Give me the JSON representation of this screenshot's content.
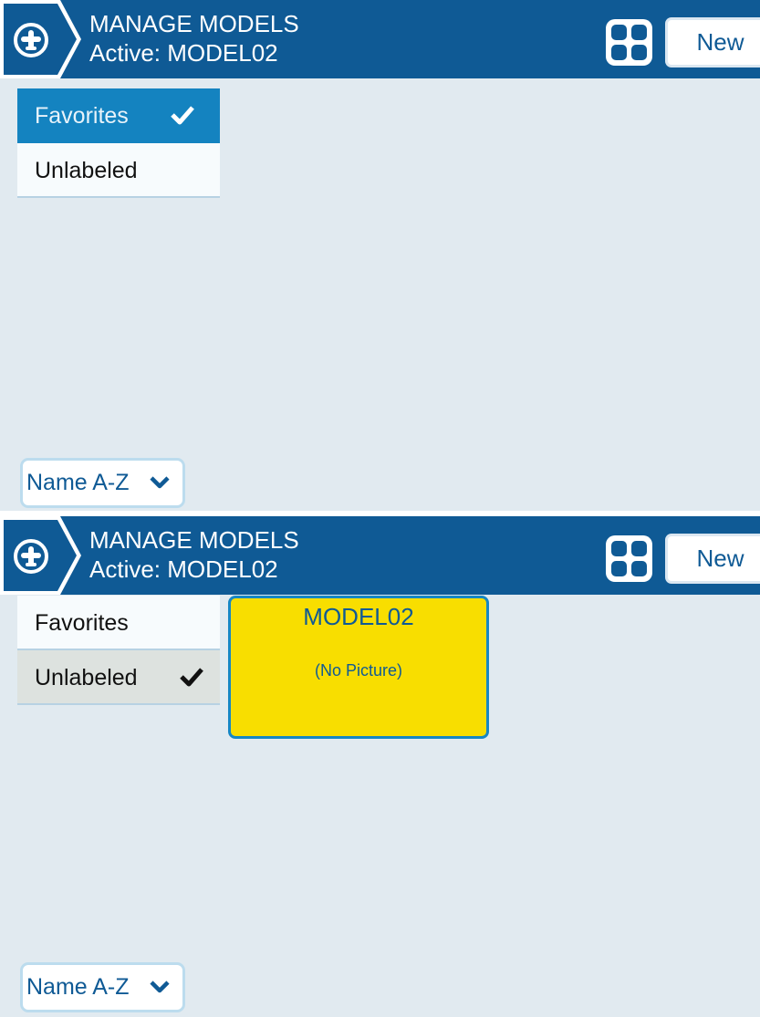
{
  "colors": {
    "header_bg": "#0f5a95",
    "screen_bg": "#e1eaf0",
    "accent_blue": "#1483c0",
    "model_card_bg": "#f8de00",
    "selected_gray": "#dde2df"
  },
  "screen1": {
    "header": {
      "title": "MANAGE MODELS",
      "active": "Active: MODEL02",
      "model_icon": "airplane-icon",
      "layout_icon": "grid-layout-icon",
      "new_label": "New"
    },
    "labels": [
      {
        "label": "Favorites",
        "selected": true
      },
      {
        "label": "Unlabeled",
        "selected": false
      }
    ],
    "sort": {
      "value": "Name A-Z",
      "icon": "chevron-down-icon"
    }
  },
  "screen2": {
    "header": {
      "title": "MANAGE MODELS",
      "active": "Active: MODEL02",
      "model_icon": "airplane-icon",
      "layout_icon": "grid-layout-icon",
      "new_label": "New"
    },
    "labels": [
      {
        "label": "Favorites",
        "selected": false
      },
      {
        "label": "Unlabeled",
        "selected": true
      }
    ],
    "models": [
      {
        "name": "MODEL02",
        "picture": "(No Picture)"
      }
    ],
    "sort": {
      "value": "Name A-Z",
      "icon": "chevron-down-icon"
    }
  }
}
